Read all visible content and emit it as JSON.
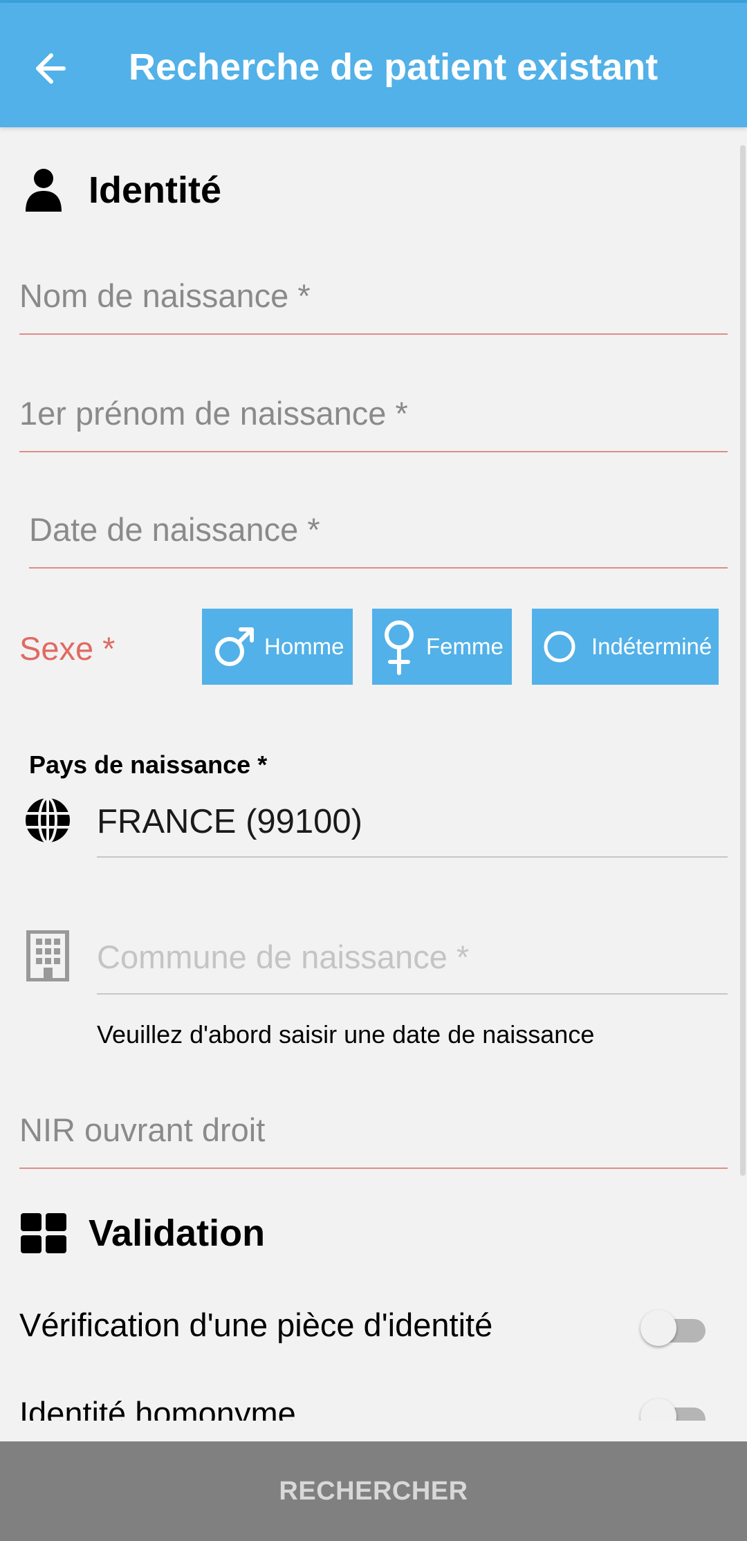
{
  "appbar": {
    "title": "Recherche de patient existant"
  },
  "identite": {
    "title": "Identité",
    "nom_placeholder": "Nom de naissance *",
    "prenom_placeholder": "1er prénom de naissance *",
    "date_placeholder": "Date de naissance *",
    "sexe_label": "Sexe *",
    "sexe_options": [
      "Homme",
      "Femme",
      "Indéterminé"
    ],
    "pays_label": "Pays de naissance *",
    "pays_value": "FRANCE (99100)",
    "commune_placeholder": "Commune de naissance *",
    "commune_helper": "Veuillez d'abord saisir une date de naissance",
    "nir_placeholder": "NIR ouvrant droit"
  },
  "validation": {
    "title": "Validation",
    "toggles": [
      {
        "label": "Vérification d'une pièce d'identité",
        "on": false
      },
      {
        "label": "Identité homonyme",
        "on": false
      }
    ]
  },
  "actions": {
    "search_label": "RECHERCHER"
  },
  "colors": {
    "primary": "#52b1e8",
    "error": "#e06a62",
    "background": "#f2f2f2",
    "bottom_bar": "#808080"
  },
  "icons": {
    "back": "arrow-left-icon",
    "identite": "person-icon",
    "homme": "male-icon",
    "femme": "female-icon",
    "indetermine": "circle-icon",
    "pays": "globe-icon",
    "commune": "building-icon",
    "validation": "grid-icon"
  }
}
